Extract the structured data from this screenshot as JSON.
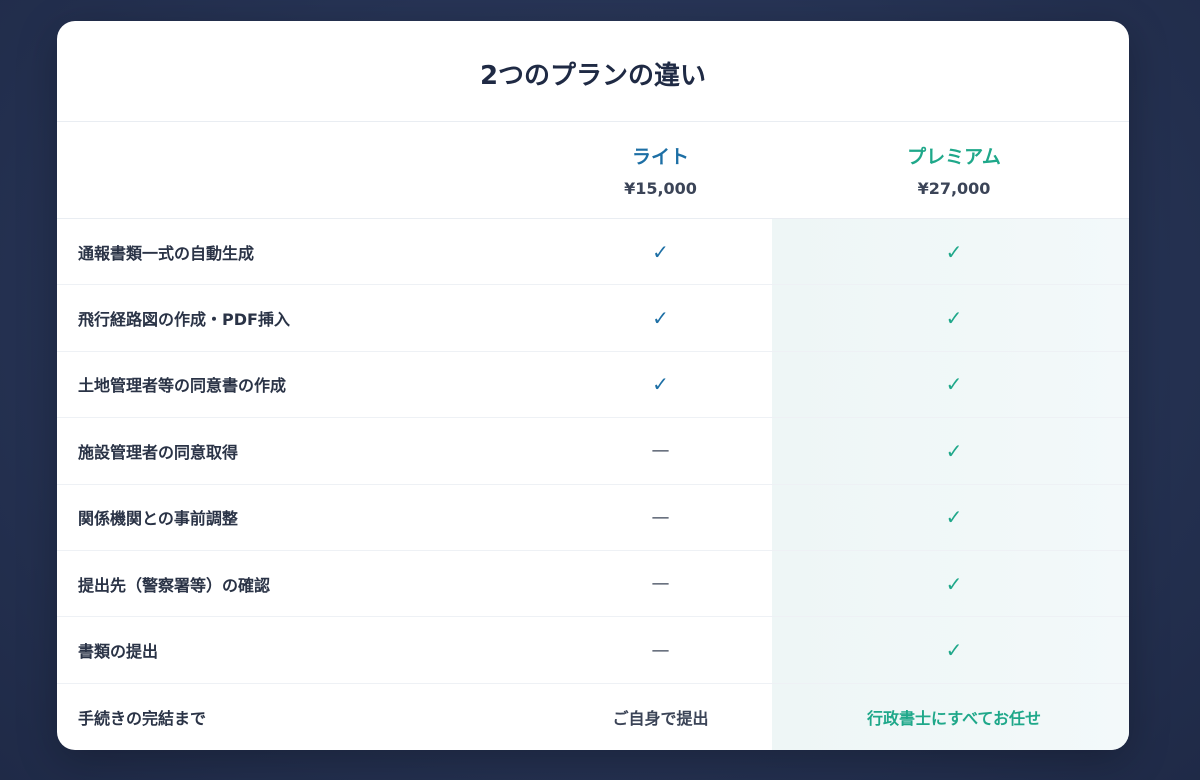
{
  "title": "2つのプランの違い",
  "plans": {
    "lite": {
      "name": "ライト",
      "price": "¥15,000"
    },
    "premium": {
      "name": "プレミアム",
      "price": "¥27,000"
    }
  },
  "symbols": {
    "check": "✓",
    "dash": "—"
  },
  "rows": [
    {
      "feature": "通報書類一式の自動生成",
      "lite": "✓",
      "premium": "✓"
    },
    {
      "feature": "飛行経路図の作成・PDF挿入",
      "lite": "✓",
      "premium": "✓"
    },
    {
      "feature": "土地管理者等の同意書の作成",
      "lite": "✓",
      "premium": "✓"
    },
    {
      "feature": "施設管理者の同意取得",
      "lite": "—",
      "premium": "✓"
    },
    {
      "feature": "関係機関との事前調整",
      "lite": "—",
      "premium": "✓"
    },
    {
      "feature": "提出先（警察署等）の確認",
      "lite": "—",
      "premium": "✓"
    },
    {
      "feature": "書類の提出",
      "lite": "—",
      "premium": "✓"
    },
    {
      "feature": "手続きの完結まで",
      "lite": "ご自身で提出",
      "premium": "行政書士にすべてお任せ"
    }
  ],
  "colors": {
    "lite_accent": "#1d6fa5",
    "premium_accent": "#1fa88a",
    "background": "#263354",
    "card": "#ffffff"
  }
}
